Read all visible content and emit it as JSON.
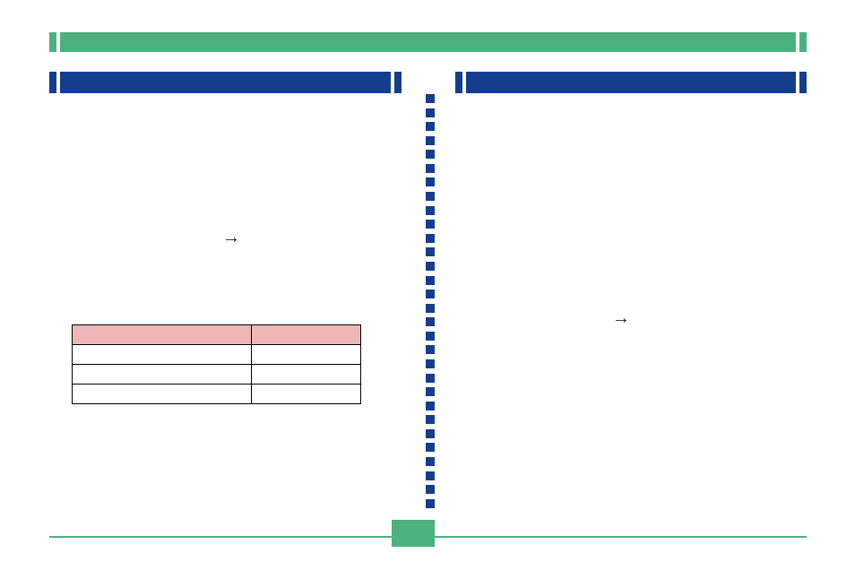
{
  "colors": {
    "green": "#4bb17e",
    "blue": "#143d8e",
    "tableHeader": "#eeb7b7"
  },
  "header": {
    "title": ""
  },
  "left": {
    "heading": "",
    "arrow_label": "",
    "table": {
      "headers": [
        "",
        ""
      ],
      "rows": [
        [
          "",
          ""
        ],
        [
          "",
          ""
        ],
        [
          "",
          ""
        ]
      ]
    }
  },
  "right": {
    "heading": "",
    "arrow_label": ""
  },
  "footer": {
    "page": ""
  }
}
